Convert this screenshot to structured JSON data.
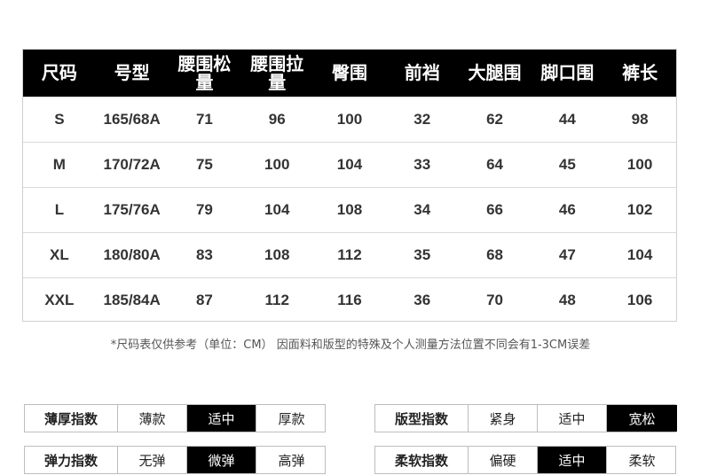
{
  "size_table": {
    "headers": [
      "尺码",
      "号型",
      "腰围松量",
      "腰围拉量",
      "臀围",
      "前裆",
      "大腿围",
      "脚口围",
      "裤长"
    ],
    "rows": [
      [
        "S",
        "165/68A",
        "71",
        "96",
        "100",
        "32",
        "62",
        "44",
        "98"
      ],
      [
        "M",
        "170/72A",
        "75",
        "100",
        "104",
        "33",
        "64",
        "45",
        "100"
      ],
      [
        "L",
        "175/76A",
        "79",
        "104",
        "108",
        "34",
        "66",
        "46",
        "102"
      ],
      [
        "XL",
        "180/80A",
        "83",
        "108",
        "112",
        "35",
        "68",
        "47",
        "104"
      ],
      [
        "XXL",
        "185/84A",
        "87",
        "112",
        "116",
        "36",
        "70",
        "48",
        "106"
      ]
    ]
  },
  "note": "*尺码表仅供参考（单位：CM） 因面料和版型的特殊及个人测量方法位置不同会有1-3CM误差",
  "indices": {
    "thickness": {
      "label": "薄厚指数",
      "options": [
        "薄款",
        "适中",
        "厚款"
      ],
      "selected": "适中"
    },
    "elasticity": {
      "label": "弹力指数",
      "options": [
        "无弹",
        "微弹",
        "高弹"
      ],
      "selected": "微弹"
    },
    "fit": {
      "label": "版型指数",
      "options": [
        "紧身",
        "适中",
        "宽松"
      ],
      "selected": "宽松"
    },
    "softness": {
      "label": "柔软指数",
      "options": [
        "偏硬",
        "适中",
        "柔软"
      ],
      "selected": "适中"
    }
  }
}
